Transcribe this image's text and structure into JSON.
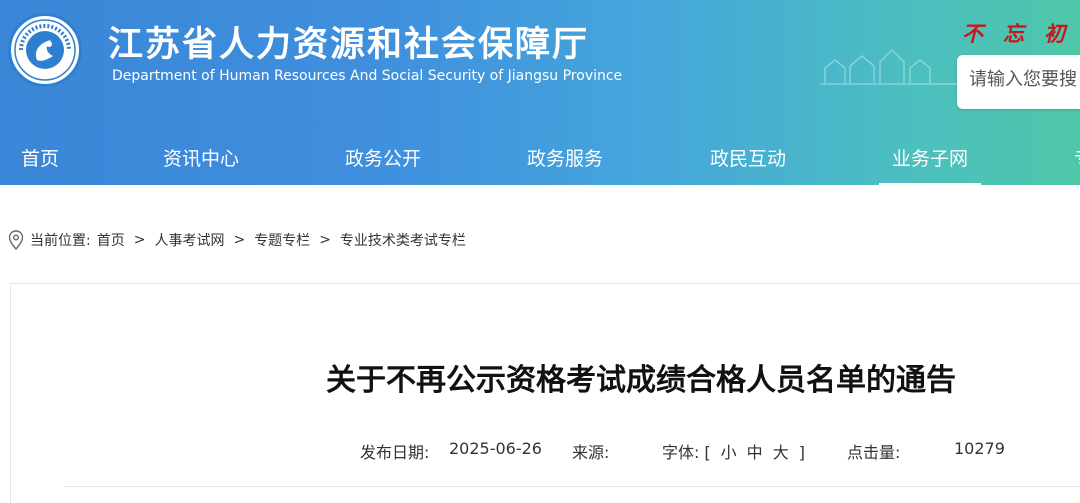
{
  "header": {
    "title_zh": "江苏省人力资源和社会保障厅",
    "title_en": "Department of Human Resources And Social Security of Jiangsu Province",
    "motto_chars": [
      "不",
      "忘",
      "初"
    ],
    "search_placeholder": "请输入您要搜"
  },
  "nav": {
    "items": [
      "首页",
      "资讯中心",
      "政务公开",
      "政务服务",
      "政民互动",
      "业务子网",
      "专"
    ],
    "active": "业务子网"
  },
  "breadcrumb": {
    "label": "当前位置:",
    "items": [
      "首页",
      "人事考试网",
      "专题专栏",
      "专业技术类考试专栏"
    ],
    "separator": ">"
  },
  "article": {
    "title": "关于不再公示资格考试成绩合格人员名单的通告",
    "publish_label": "发布日期:",
    "publish_date": "2025-06-26",
    "source_label": "来源:",
    "source_value": "",
    "font_label": "字体:",
    "font_open": "[",
    "font_small": "小",
    "font_medium": "中",
    "font_large": "大",
    "font_close": "]",
    "clicks_label": "点击量:",
    "clicks_value": "10279"
  },
  "colors": {
    "header_start": "#3a86d8",
    "header_end": "#4ec7a8",
    "motto": "#c8161d"
  },
  "icons": {
    "logo": "emblem-logo",
    "breadcrumb": "location-pin-icon"
  }
}
